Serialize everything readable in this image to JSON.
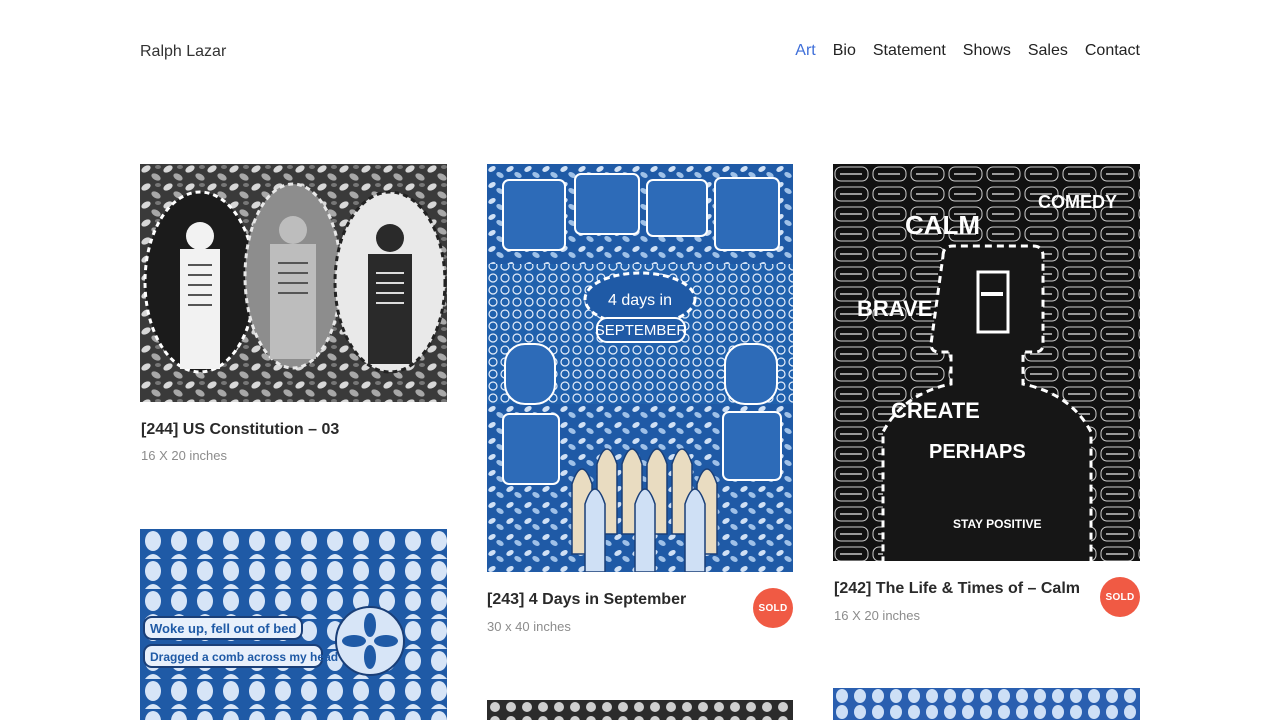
{
  "site": {
    "title": "Ralph Lazar"
  },
  "nav": {
    "items": [
      {
        "label": "Art",
        "active": true
      },
      {
        "label": "Bio",
        "active": false
      },
      {
        "label": "Statement",
        "active": false
      },
      {
        "label": "Shows",
        "active": false
      },
      {
        "label": "Sales",
        "active": false
      },
      {
        "label": "Contact",
        "active": false
      }
    ]
  },
  "colors": {
    "accent": "#3f6fd9",
    "sold": "#f05a44",
    "muted": "#8c8c8c"
  },
  "gallery": {
    "items": [
      {
        "title": "[244] US Constitution – 03",
        "size": "16 X 20 inches",
        "sold": false
      },
      {
        "title": "[243] 4 Days in September",
        "size": "30 x 40 inches",
        "sold": true,
        "sold_label": "SOLD",
        "art_text": [
          "4 days in",
          "SEPTEMBER"
        ]
      },
      {
        "title": "[242] The Life & Times of – Calm",
        "size": "16 X 20 inches",
        "sold": true,
        "sold_label": "SOLD",
        "art_text": [
          "COMEDY",
          "CALM",
          "BRAVE",
          "CREATE",
          "PERHAPS",
          "STAY POSITIVE"
        ]
      },
      {
        "art_text": [
          "Woke up, fell out of bed",
          "Dragged a comb across my head"
        ]
      }
    ]
  }
}
